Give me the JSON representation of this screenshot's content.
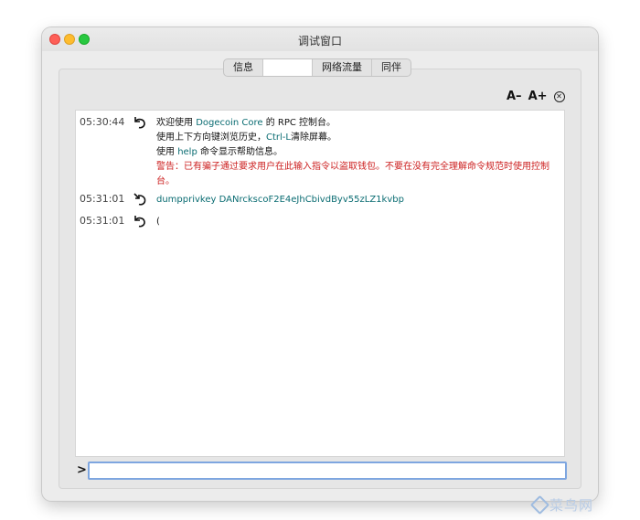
{
  "window": {
    "title": "调试窗口"
  },
  "tabs": [
    {
      "label": "信息"
    },
    {
      "label": ""
    },
    {
      "label": "网络流量"
    },
    {
      "label": "同伴"
    }
  ],
  "font_controls": {
    "decrease": "A–",
    "increase": "A+",
    "clear": "✕"
  },
  "console": {
    "messages": [
      {
        "time": "05:30:44",
        "line1": {
          "pre": "欢迎使用 ",
          "kw": "Dogecoin Core",
          "post": " 的 RPC 控制台。"
        },
        "line2": {
          "pre": "使用上下方向键浏览历史，",
          "kw": "Ctrl-L",
          "post": "清除屏幕。"
        },
        "line3": {
          "pre": "使用 ",
          "kw": "help",
          "post": " 命令显示帮助信息。"
        },
        "warning": "警告：已有骗子通过要求用户在此输入指令以盗取钱包。不要在没有完全理解命令规范时使用控制台。"
      },
      {
        "time": "05:31:01",
        "text": "dumpprivkey DANrckscoF2E4eJhCbivdByv55zLZ1kvbp"
      },
      {
        "time": "05:31:01",
        "text": "("
      }
    ]
  },
  "input": {
    "prompt": ">",
    "value": ""
  },
  "watermark": {
    "text": "菜鸟网"
  }
}
